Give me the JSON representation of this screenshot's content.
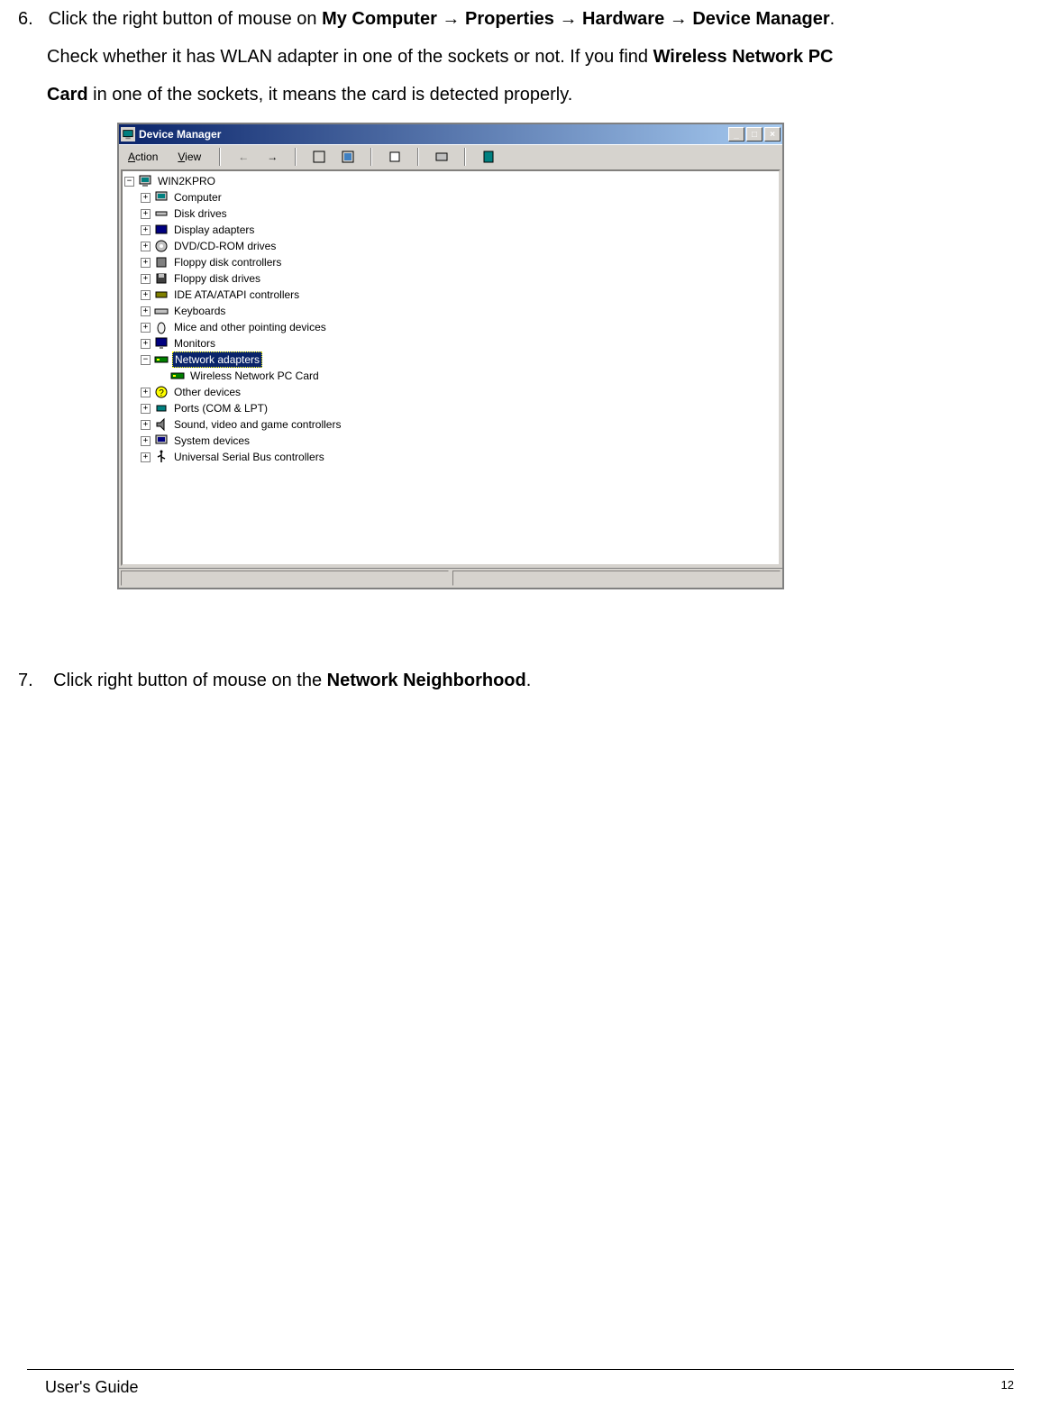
{
  "steps": {
    "s6": {
      "num": "6.",
      "t1": "Click the right button of mouse on ",
      "b1": "My Computer",
      "arr": " → ",
      "b2": "Properties",
      "b3": "Hardware",
      "b4": "Device Manager",
      "t2": ".",
      "t3": "Check whether it has WLAN adapter in one of the sockets or not.  If you find ",
      "b5": "Wireless Network PC",
      "b6": "Card",
      "t4": " in one of the sockets, it means the card is detected properly."
    },
    "s7": {
      "num": "7.",
      "t1": "Click right button of mouse on the ",
      "b1": "Network Neighborhood",
      "t2": "."
    }
  },
  "dm": {
    "title": "Device Manager",
    "menu": {
      "action": "Action",
      "view": "View"
    },
    "tree": {
      "root": "WIN2KPRO",
      "items": [
        "Computer",
        "Disk drives",
        "Display adapters",
        "DVD/CD-ROM drives",
        "Floppy disk controllers",
        "Floppy disk drives",
        "IDE ATA/ATAPI controllers",
        "Keyboards",
        "Mice and other pointing devices",
        "Monitors"
      ],
      "network": "Network adapters",
      "network_child": "Wireless Network PC Card",
      "after": [
        "Other devices",
        "Ports (COM & LPT)",
        "Sound, video and game controllers",
        "System devices",
        "Universal Serial Bus controllers"
      ]
    }
  },
  "footer": {
    "guide": "User's Guide",
    "page": "12"
  },
  "glyph": {
    "plus": "+",
    "minus": "−",
    "arrow_left": "←",
    "arrow_right": "→",
    "min": "_",
    "max": "□",
    "close": "×"
  }
}
